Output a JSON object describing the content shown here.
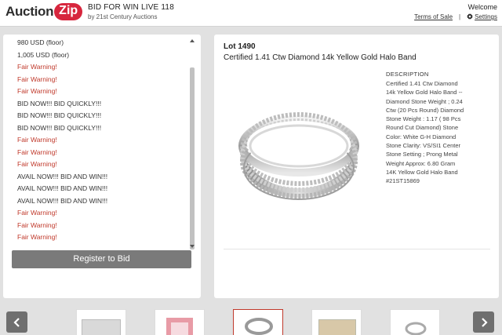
{
  "header": {
    "logo_auction": "Auction",
    "logo_zip": "Zip",
    "auction_title": "BID FOR WIN LIVE 118",
    "auction_subtitle": "by 21st Century Auctions",
    "welcome": "Welcome",
    "terms_link": "Terms of Sale",
    "separator": "|",
    "settings_link": "Settings"
  },
  "feed": {
    "lines": [
      {
        "text": "980 USD (floor)",
        "type": "normal"
      },
      {
        "text": "1,005 USD (floor)",
        "type": "normal"
      },
      {
        "text": "Fair Warning!",
        "type": "warn"
      },
      {
        "text": "Fair Warning!",
        "type": "warn"
      },
      {
        "text": "Fair Warning!",
        "type": "warn"
      },
      {
        "text": "BID NOW!!! BID QUICKLY!!!",
        "type": "normal"
      },
      {
        "text": "BID NOW!!! BID QUICKLY!!!",
        "type": "normal"
      },
      {
        "text": "BID NOW!!! BID QUICKLY!!!",
        "type": "normal"
      },
      {
        "text": "Fair Warning!",
        "type": "warn"
      },
      {
        "text": "Fair Warning!",
        "type": "warn"
      },
      {
        "text": "Fair Warning!",
        "type": "warn"
      },
      {
        "text": "AVAIL NOW!!! BID AND WIN!!!",
        "type": "normal"
      },
      {
        "text": "AVAIL NOW!!! BID AND WIN!!!",
        "type": "normal"
      },
      {
        "text": "AVAIL NOW!!! BID AND WIN!!!",
        "type": "normal"
      },
      {
        "text": "Fair Warning!",
        "type": "warn"
      },
      {
        "text": "Fair Warning!",
        "type": "warn"
      },
      {
        "text": "Fair Warning!",
        "type": "warn"
      }
    ],
    "register_button": "Register to Bid"
  },
  "lot": {
    "number": "Lot 1490",
    "title": "Certified 1.41 Ctw Diamond 14k Yellow Gold Halo Band",
    "description_heading": "DESCRIPTION",
    "description_lines": [
      "Certified 1.41 Ctw Diamond",
      "14k Yellow Gold Halo Band --",
      "Diamond Stone Weight ; 0.24",
      "Ctw (20 Pcs Round) Diamond",
      "Stone Weight : 1.17 ( 98 Pcs",
      "Round Cut Diamond) Stone",
      "Color: White G-H Diamond",
      "Stone Clarity: VS/SI1 Center",
      "Stone Setting ; Prong Metal",
      "Weight Approx: 6.80 Gram",
      "14K Yellow Gold Halo Band",
      "#21ST15869"
    ]
  },
  "thumbnails": {
    "icons": [
      "chevron-left-icon",
      "chevron-right-icon"
    ],
    "items": [
      "silver-box",
      "pink-item",
      "ring",
      "tan-box",
      "jewelry"
    ]
  },
  "colors": {
    "accent": "#d7263d",
    "warning_text": "#c0392b",
    "button_gray": "#7a7a7a"
  }
}
